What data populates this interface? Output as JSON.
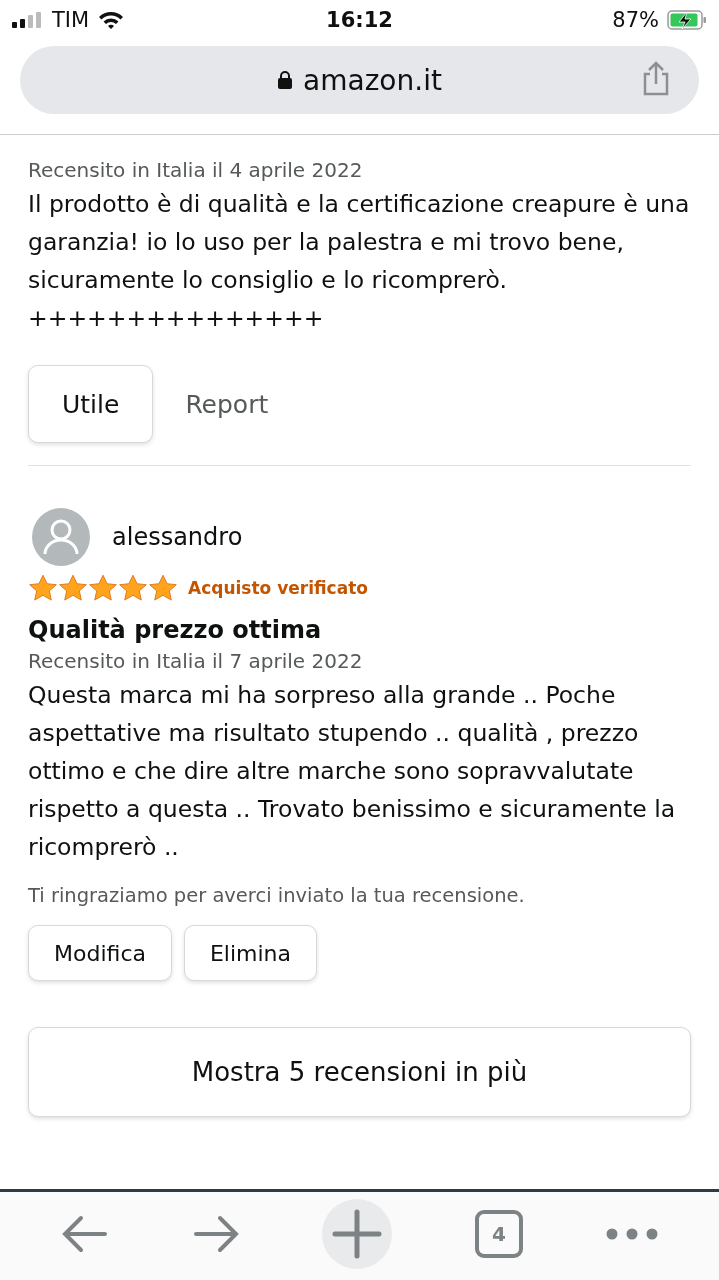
{
  "status_bar": {
    "carrier": "TIM",
    "time": "16:12",
    "battery": "87%"
  },
  "address_bar": {
    "url": "amazon.it"
  },
  "reviews": [
    {
      "kind": "tail",
      "date": "Recensito in Italia il 4 aprile 2022",
      "body": "Il prodotto è di qualità e la certificazione creapure è una garanzia! io lo uso per la palestra e mi trovo bene, sicuramente lo consiglio e lo ricomprerò. +++++++++++++++",
      "buttons": [
        "Utile"
      ],
      "report": "Report"
    },
    {
      "kind": "own",
      "author": "alessandro",
      "stars": 5,
      "badge": "Acquisto verificato",
      "title": "Qualità prezzo ottima",
      "date": "Recensito in Italia il 7 aprile 2022",
      "body": "Questa marca mi ha sorpreso alla grande .. Poche aspettative ma risultato stupendo .. qualità , prezzo ottimo e che dire altre marche sono sopravvalutate rispetto a questa .. Trovato benissimo e sicuramente la ricomprerò ..",
      "note": "Ti ringraziamo per averci inviato la tua recensione.",
      "buttons": [
        "Modifica",
        "Elimina"
      ]
    }
  ],
  "more_button": "Mostra 5 recensioni in più",
  "toolbar": {
    "tab_count": "4"
  }
}
